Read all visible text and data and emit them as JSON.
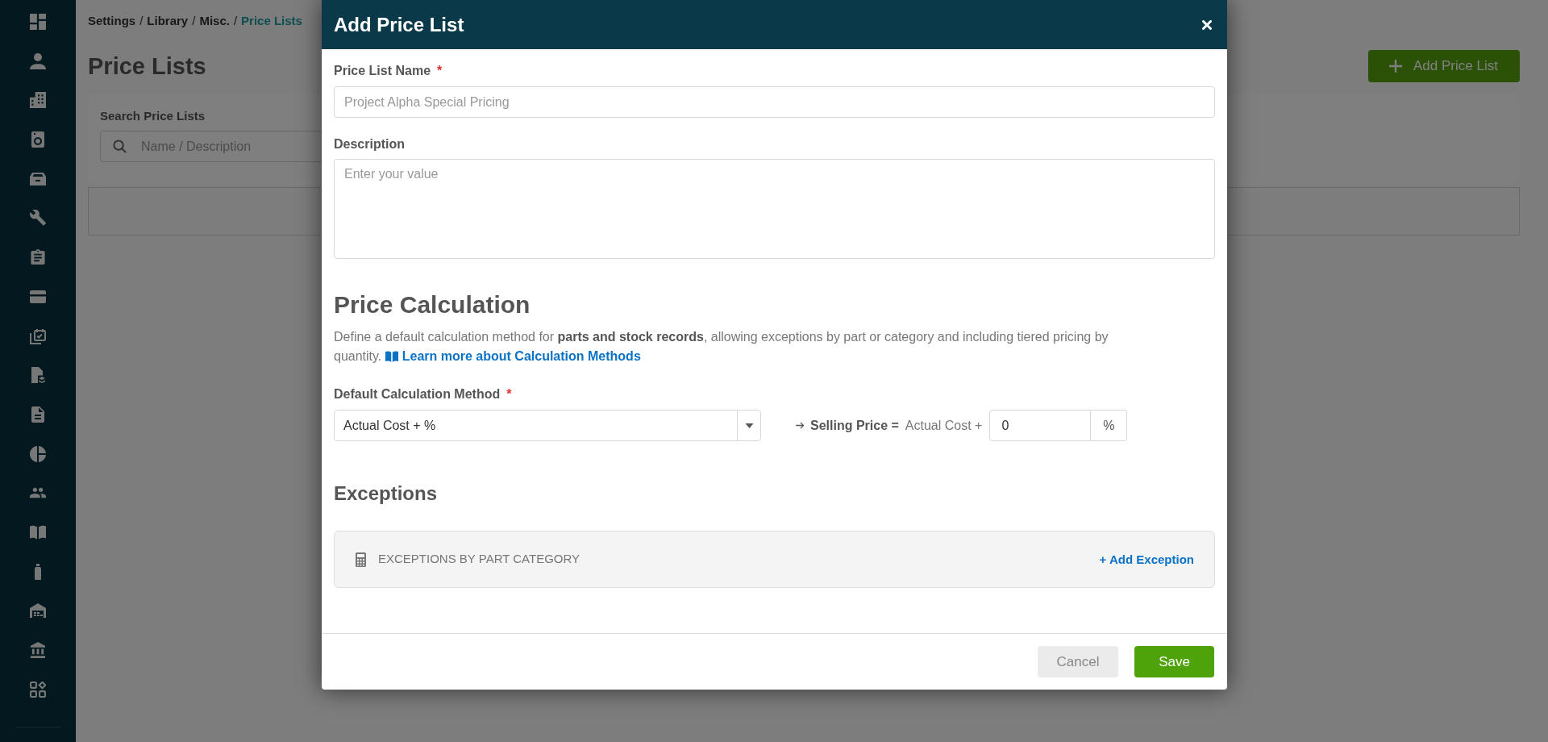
{
  "breadcrumb": [
    {
      "label": "Settings",
      "separator": "/",
      "current": false
    },
    {
      "label": "Library",
      "separator": "/",
      "current": false
    },
    {
      "label": "Misc.",
      "separator": "/",
      "current": false
    },
    {
      "label": "Price Lists",
      "current": true
    }
  ],
  "page": {
    "title": "Price Lists",
    "add_button": {
      "label": "Add Price List"
    },
    "search": {
      "label": "Search Price Lists",
      "placeholder": "Name / Description"
    }
  },
  "dialog": {
    "title": "Add Price List",
    "fields": [
      {
        "kind": "text",
        "label": "Price List Name",
        "required_mark": "*",
        "placeholder": "Project Alpha Special Pricing"
      },
      {
        "kind": "textarea",
        "label": "Description",
        "placeholder": "Enter your value"
      }
    ],
    "price_calculation": {
      "heading": "Price Calculation",
      "description": "Define a default calculation method for **parts and stock records**, allowing exceptions by part or category and including tiered pricing by quantity.",
      "link": "Learn more about Calculation Methods",
      "method": {
        "label": "Default Calculation Method",
        "required_mark": "*",
        "value": "Actual Cost + %"
      },
      "formula": {
        "label": "Selling Price =",
        "base": "Actual Cost +",
        "value": "0",
        "unit": "%"
      }
    },
    "exceptions": {
      "heading": "Exceptions",
      "panel": {
        "title": "EXCEPTIONS BY PART CATEGORY",
        "action": "+ Add Exception"
      }
    },
    "buttons": [
      {
        "kind": "secondary",
        "label": "Cancel"
      },
      {
        "kind": "primary",
        "label": "Save"
      }
    ]
  }
}
